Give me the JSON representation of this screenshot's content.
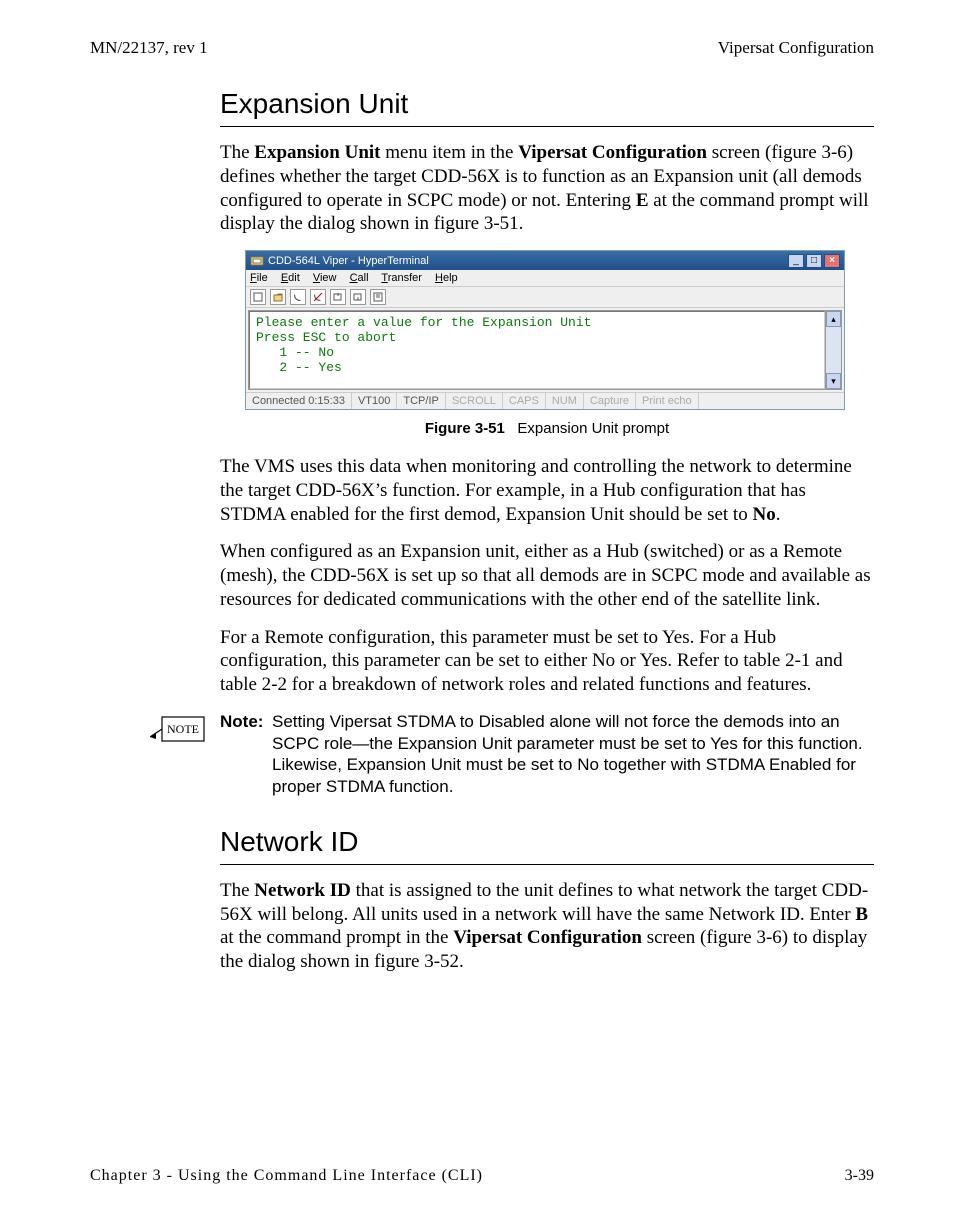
{
  "header": {
    "left": "MN/22137, rev 1",
    "right": "Vipersat Configuration"
  },
  "section1": {
    "title": "Expansion Unit",
    "p1_a": "The ",
    "p1_b": "Expansion Unit",
    "p1_c": " menu item in the ",
    "p1_d": "Vipersat Configuration",
    "p1_e": " screen (figure 3-6) defines whether the target CDD-56X is to function as an Expansion unit (all demods configured to operate in SCPC mode) or not. Entering ",
    "p1_f": "E",
    "p1_g": " at the command prompt will display the dialog shown in figure 3-51."
  },
  "figure": {
    "window_title": "CDD-564L Viper - HyperTerminal",
    "menus": {
      "file": "File",
      "edit": "Edit",
      "view": "View",
      "call": "Call",
      "transfer": "Transfer",
      "help": "Help"
    },
    "terminal_text": "Please enter a value for the Expansion Unit\nPress ESC to abort\n   1 -- No\n   2 -- Yes",
    "status": {
      "connected": "Connected 0:15:33",
      "emu": "VT100",
      "proto": "TCP/IP",
      "scroll": "SCROLL",
      "caps": "CAPS",
      "num": "NUM",
      "capture": "Capture",
      "echo": "Print echo"
    },
    "caption_num": "Figure 3-51",
    "caption_text": "Expansion Unit prompt"
  },
  "after_fig": {
    "p2_a": "The VMS uses this data when monitoring and controlling the network to determine the target CDD-56X’s function. For example, in a Hub configuration that has STDMA enabled for the first demod, Expansion Unit should be set to ",
    "p2_b": "No",
    "p2_c": ".",
    "p3": "When configured as an Expansion unit, either as a Hub (switched) or as a Remote (mesh), the CDD-56X is set up so that all demods are in SCPC mode and available as resources for dedicated communications with the other end of the satellite link.",
    "p4": "For a Remote configuration, this parameter must be set to Yes. For a Hub configuration, this parameter can be set to either No or Yes. Refer to table 2-1 and table 2-2 for a breakdown of network roles and related functions and features."
  },
  "note": {
    "icon_label": "NOTE",
    "label": "Note:",
    "body": "Setting Vipersat STDMA to Disabled alone will not force the demods into an SCPC role—the Expansion Unit parameter must be set to Yes for this function. Likewise, Expansion Unit must be set to No together with STDMA Enabled for proper STDMA function."
  },
  "section2": {
    "title": "Network ID",
    "p1_a": "The ",
    "p1_b": "Network ID",
    "p1_c": " that is assigned to the unit defines to what network the target CDD-56X will belong. All units used in a network will have the same Network ID. Enter ",
    "p1_d": "B",
    "p1_e": " at the command prompt in the ",
    "p1_f": "Vipersat Configuration",
    "p1_g": " screen (figure 3-6) to display the dialog shown in figure 3-52."
  },
  "footer": {
    "chapter": "Chapter 3 - Using the Command Line Interface (CLI)",
    "page": "3-39"
  }
}
